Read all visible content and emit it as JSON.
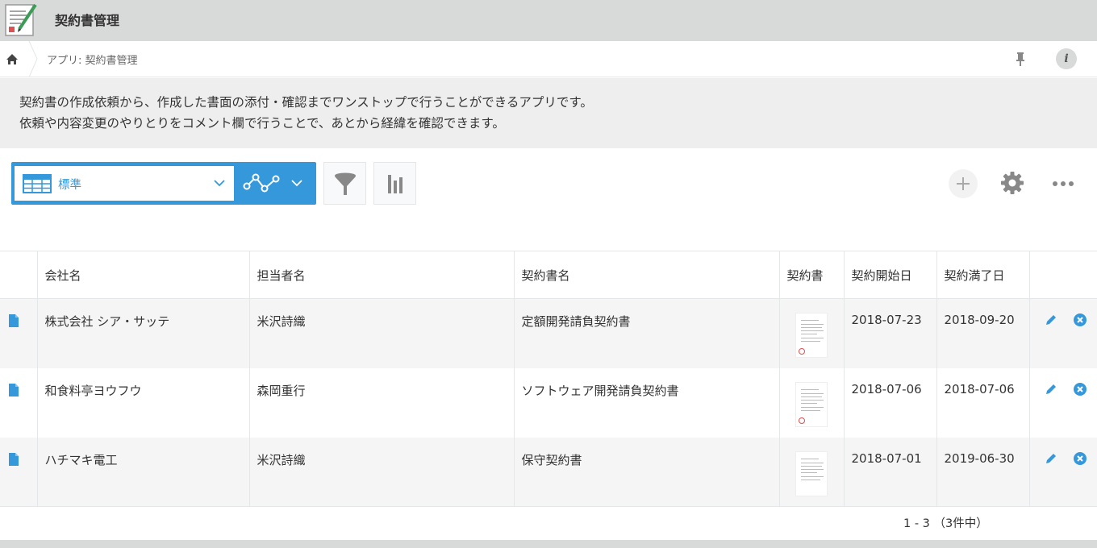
{
  "app": {
    "title": "契約書管理"
  },
  "breadcrumb": {
    "text": "アプリ: 契約書管理"
  },
  "description": {
    "line1": "契約書の作成依頼から、作成した書面の添付・確認までワンストップで行うことができるアプリです。",
    "line2": "依頼や内容変更のやりとりをコメント欄で行うことで、あとから経緯を確認できます。"
  },
  "toolbar": {
    "view_label": "標準",
    "accent": "#3498db"
  },
  "table": {
    "headers": [
      "会社名",
      "担当者名",
      "契約書名",
      "契約書",
      "契約開始日",
      "契約満了日"
    ],
    "rows": [
      {
        "company": "株式会社 シア・サッテ",
        "person": "米沢詩織",
        "contract": "定額開発請負契約書",
        "start": "2018-07-23",
        "end": "2018-09-20"
      },
      {
        "company": "和食料亭ヨウフウ",
        "person": "森岡重行",
        "contract": "ソフトウェア開発請負契約書",
        "start": "2018-07-06",
        "end": "2018-07-06"
      },
      {
        "company": "ハチマキ電工",
        "person": "米沢詩織",
        "contract": "保守契約書",
        "start": "2018-07-01",
        "end": "2019-06-30"
      }
    ]
  },
  "pager": {
    "text": "1 - 3 （3件中）"
  }
}
